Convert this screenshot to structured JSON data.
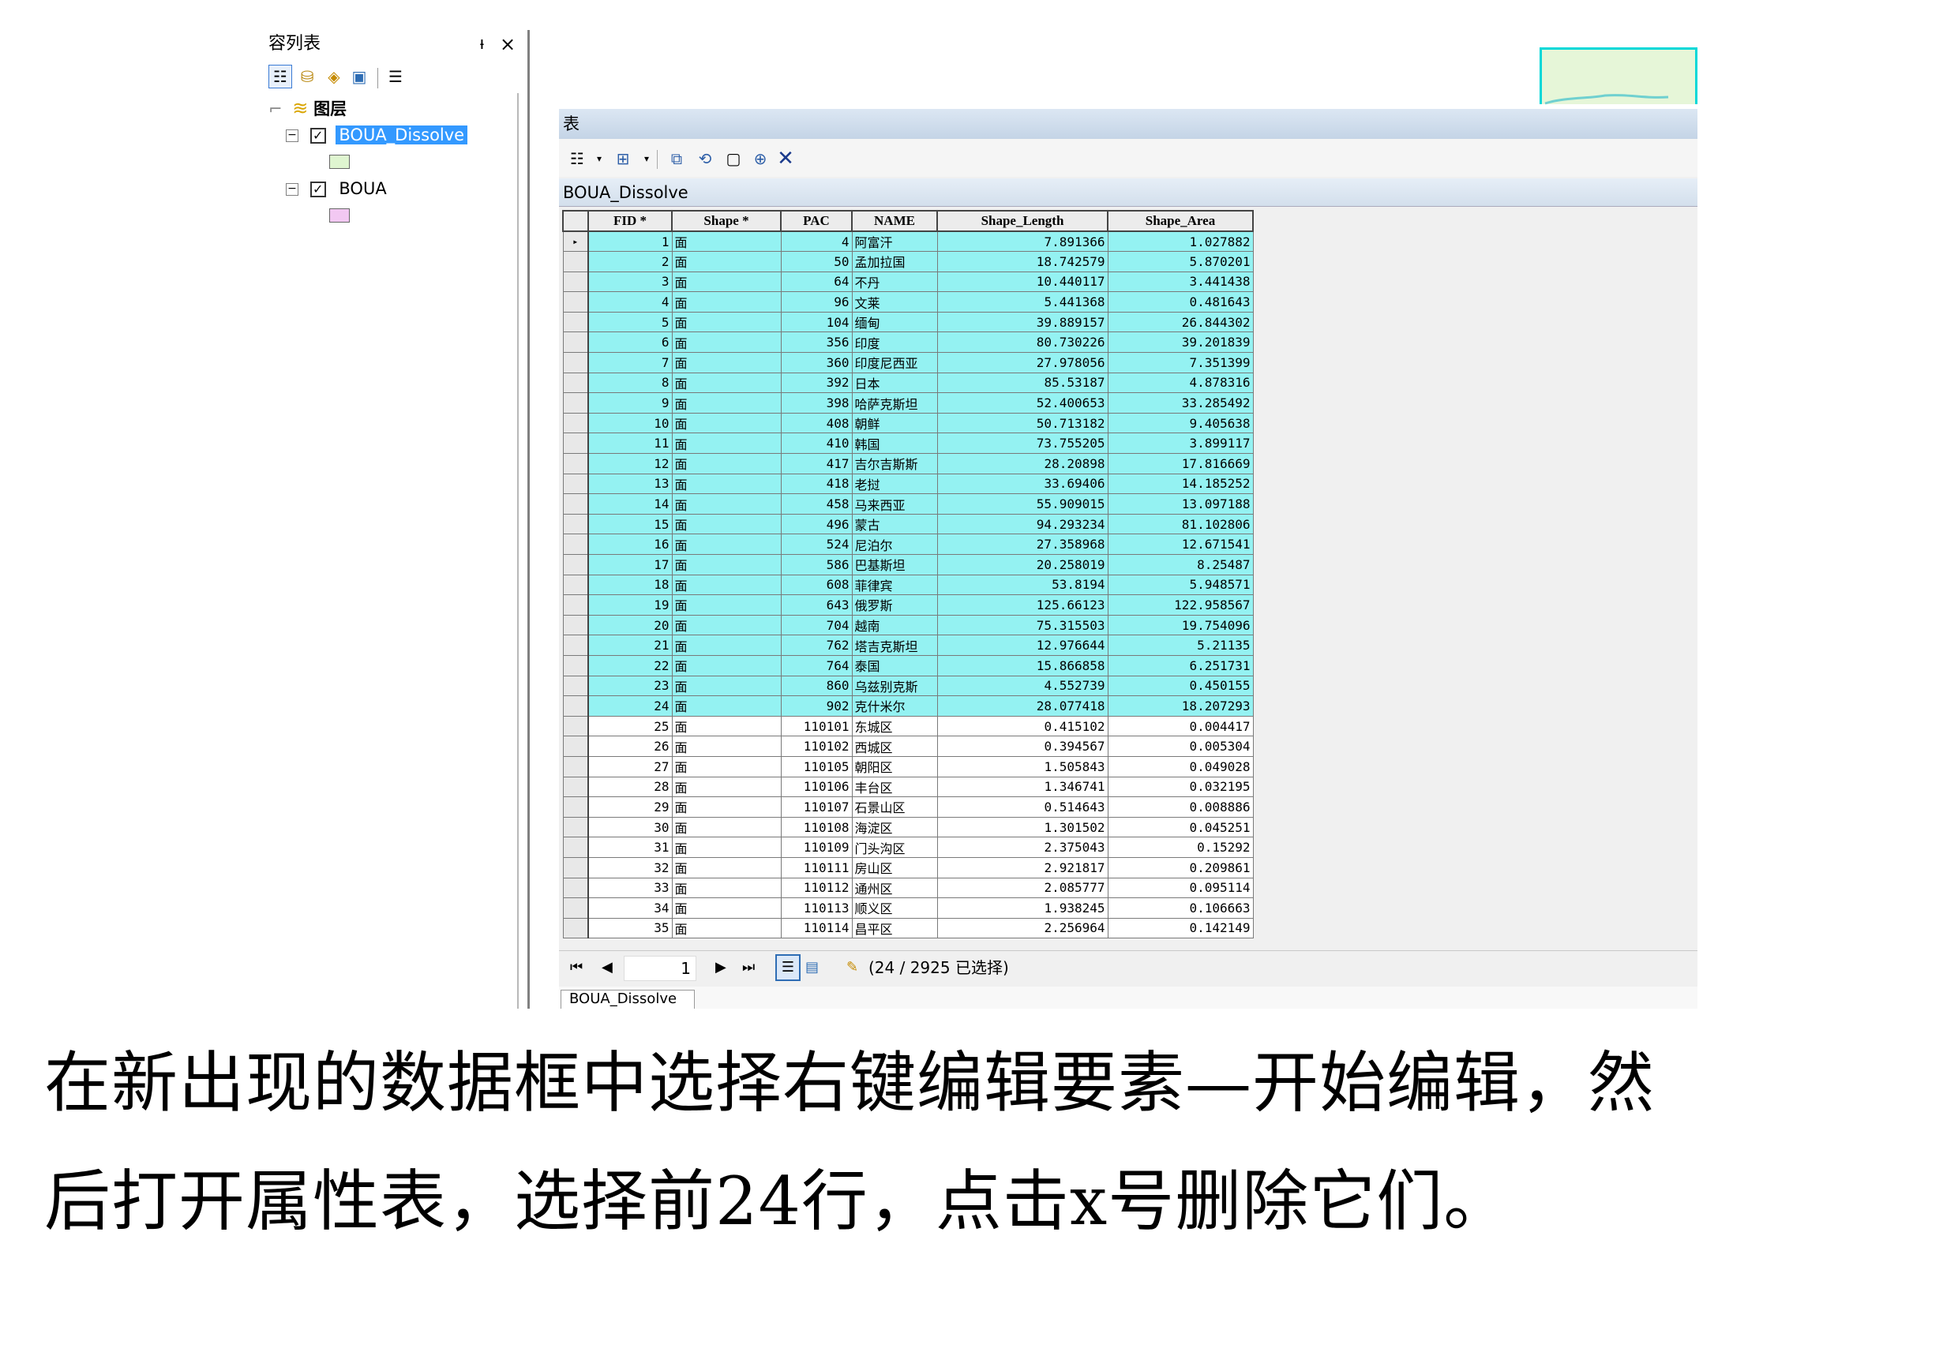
{
  "toc": {
    "title": "容列表",
    "pin_glyph": "ꟷ",
    "close_glyph": "×",
    "root_label": "图层",
    "layers": [
      {
        "name": "BOUA_Dissolve",
        "checked": true,
        "selected": true,
        "swatch_color": "#dff5d0"
      },
      {
        "name": "BOUA",
        "checked": true,
        "selected": false,
        "swatch_color": "#f2c8f2"
      }
    ]
  },
  "table_window": {
    "title": "表",
    "layer_name": "BOUA_Dissolve",
    "columns": [
      "FID *",
      "Shape *",
      "PAC",
      "NAME",
      "Shape_Length",
      "Shape_Area"
    ],
    "rows": [
      {
        "fid": "1",
        "shape": "面",
        "pac": "4",
        "name": "阿富汗",
        "len": "7.891366",
        "area": "1.027882",
        "sel": true,
        "cur": true
      },
      {
        "fid": "2",
        "shape": "面",
        "pac": "50",
        "name": "孟加拉国",
        "len": "18.742579",
        "area": "5.870201",
        "sel": true
      },
      {
        "fid": "3",
        "shape": "面",
        "pac": "64",
        "name": "不丹",
        "len": "10.440117",
        "area": "3.441438",
        "sel": true
      },
      {
        "fid": "4",
        "shape": "面",
        "pac": "96",
        "name": "文莱",
        "len": "5.441368",
        "area": "0.481643",
        "sel": true
      },
      {
        "fid": "5",
        "shape": "面",
        "pac": "104",
        "name": "缅甸",
        "len": "39.889157",
        "area": "26.844302",
        "sel": true
      },
      {
        "fid": "6",
        "shape": "面",
        "pac": "356",
        "name": "印度",
        "len": "80.730226",
        "area": "39.201839",
        "sel": true
      },
      {
        "fid": "7",
        "shape": "面",
        "pac": "360",
        "name": "印度尼西亚",
        "len": "27.978056",
        "area": "7.351399",
        "sel": true
      },
      {
        "fid": "8",
        "shape": "面",
        "pac": "392",
        "name": "日本",
        "len": "85.53187",
        "area": "4.878316",
        "sel": true
      },
      {
        "fid": "9",
        "shape": "面",
        "pac": "398",
        "name": "哈萨克斯坦",
        "len": "52.400653",
        "area": "33.285492",
        "sel": true
      },
      {
        "fid": "10",
        "shape": "面",
        "pac": "408",
        "name": "朝鲜",
        "len": "50.713182",
        "area": "9.405638",
        "sel": true
      },
      {
        "fid": "11",
        "shape": "面",
        "pac": "410",
        "name": "韩国",
        "len": "73.755205",
        "area": "3.899117",
        "sel": true
      },
      {
        "fid": "12",
        "shape": "面",
        "pac": "417",
        "name": "吉尔吉斯斯",
        "len": "28.20898",
        "area": "17.816669",
        "sel": true
      },
      {
        "fid": "13",
        "shape": "面",
        "pac": "418",
        "name": "老挝",
        "len": "33.69406",
        "area": "14.185252",
        "sel": true
      },
      {
        "fid": "14",
        "shape": "面",
        "pac": "458",
        "name": "马来西亚",
        "len": "55.909015",
        "area": "13.097188",
        "sel": true
      },
      {
        "fid": "15",
        "shape": "面",
        "pac": "496",
        "name": "蒙古",
        "len": "94.293234",
        "area": "81.102806",
        "sel": true
      },
      {
        "fid": "16",
        "shape": "面",
        "pac": "524",
        "name": "尼泊尔",
        "len": "27.358968",
        "area": "12.671541",
        "sel": true
      },
      {
        "fid": "17",
        "shape": "面",
        "pac": "586",
        "name": "巴基斯坦",
        "len": "20.258019",
        "area": "8.25487",
        "sel": true
      },
      {
        "fid": "18",
        "shape": "面",
        "pac": "608",
        "name": "菲律宾",
        "len": "53.8194",
        "area": "5.948571",
        "sel": true
      },
      {
        "fid": "19",
        "shape": "面",
        "pac": "643",
        "name": "俄罗斯",
        "len": "125.66123",
        "area": "122.958567",
        "sel": true
      },
      {
        "fid": "20",
        "shape": "面",
        "pac": "704",
        "name": "越南",
        "len": "75.315503",
        "area": "19.754096",
        "sel": true
      },
      {
        "fid": "21",
        "shape": "面",
        "pac": "762",
        "name": "塔吉克斯坦",
        "len": "12.976644",
        "area": "5.21135",
        "sel": true
      },
      {
        "fid": "22",
        "shape": "面",
        "pac": "764",
        "name": "泰国",
        "len": "15.866858",
        "area": "6.251731",
        "sel": true
      },
      {
        "fid": "23",
        "shape": "面",
        "pac": "860",
        "name": "乌兹别克斯",
        "len": "4.552739",
        "area": "0.450155",
        "sel": true
      },
      {
        "fid": "24",
        "shape": "面",
        "pac": "902",
        "name": "克什米尔",
        "len": "28.077418",
        "area": "18.207293",
        "sel": true
      },
      {
        "fid": "25",
        "shape": "面",
        "pac": "110101",
        "name": "东城区",
        "len": "0.415102",
        "area": "0.004417",
        "sel": false
      },
      {
        "fid": "26",
        "shape": "面",
        "pac": "110102",
        "name": "西城区",
        "len": "0.394567",
        "area": "0.005304",
        "sel": false
      },
      {
        "fid": "27",
        "shape": "面",
        "pac": "110105",
        "name": "朝阳区",
        "len": "1.505843",
        "area": "0.049028",
        "sel": false
      },
      {
        "fid": "28",
        "shape": "面",
        "pac": "110106",
        "name": "丰台区",
        "len": "1.346741",
        "area": "0.032195",
        "sel": false
      },
      {
        "fid": "29",
        "shape": "面",
        "pac": "110107",
        "name": "石景山区",
        "len": "0.514643",
        "area": "0.008886",
        "sel": false
      },
      {
        "fid": "30",
        "shape": "面",
        "pac": "110108",
        "name": "海淀区",
        "len": "1.301502",
        "area": "0.045251",
        "sel": false
      },
      {
        "fid": "31",
        "shape": "面",
        "pac": "110109",
        "name": "门头沟区",
        "len": "2.375043",
        "area": "0.15292",
        "sel": false
      },
      {
        "fid": "32",
        "shape": "面",
        "pac": "110111",
        "name": "房山区",
        "len": "2.921817",
        "area": "0.209861",
        "sel": false
      },
      {
        "fid": "33",
        "shape": "面",
        "pac": "110112",
        "name": "通州区",
        "len": "2.085777",
        "area": "0.095114",
        "sel": false
      },
      {
        "fid": "34",
        "shape": "面",
        "pac": "110113",
        "name": "顺义区",
        "len": "1.938245",
        "area": "0.106663",
        "sel": false
      },
      {
        "fid": "35",
        "shape": "面",
        "pac": "110114",
        "name": "昌平区",
        "len": "2.256964",
        "area": "0.142149",
        "sel": false
      }
    ],
    "status": {
      "page_value": "1",
      "selection_text": "(24 / 2925 已选择)"
    },
    "tab_label": "BOUA_Dissolve"
  },
  "caption": {
    "line1": "在新出现的数据框中选择右键编辑要素—开始编辑，然",
    "line2": "后打开属性表，选择前24行，点击x号删除它们。"
  },
  "colors": {
    "selected_row": "#94f2f2",
    "selected_layer": "#3399ff",
    "delete_icon": "#1a3a8c"
  }
}
